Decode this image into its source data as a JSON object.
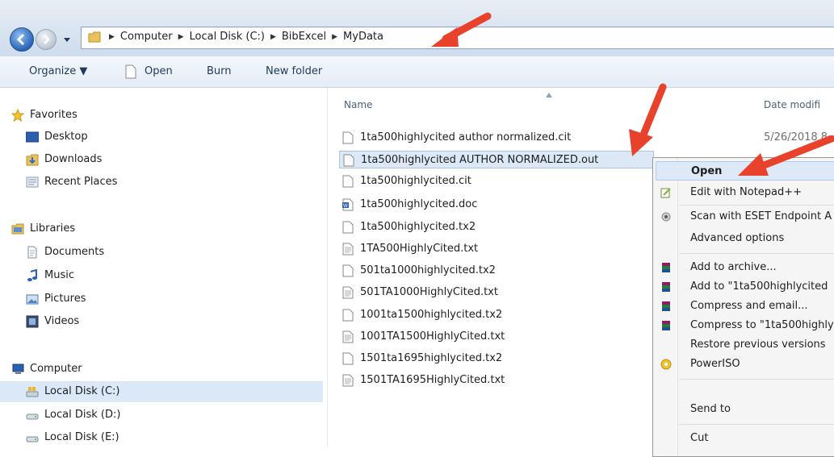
{
  "address": {
    "crumbs": [
      "Computer",
      "Local Disk (C:)",
      "BibExcel",
      "MyData"
    ]
  },
  "toolbar": {
    "organize": "Organize ▼",
    "open": "Open",
    "burn": "Burn",
    "new_folder": "New folder"
  },
  "sidebar": {
    "favorites": "Favorites",
    "desktop": "Desktop",
    "downloads": "Downloads",
    "recent": "Recent Places",
    "libraries": "Libraries",
    "documents": "Documents",
    "music": "Music",
    "pictures": "Pictures",
    "videos": "Videos",
    "computer": "Computer",
    "disk_c": "Local Disk (C:)",
    "disk_d": "Local Disk (D:)",
    "disk_e": "Local Disk (E:)"
  },
  "columns": {
    "name": "Name",
    "date": "Date modifi"
  },
  "files": [
    {
      "name": "1ta500highlycited author normalized.cit",
      "date": "5/26/2018 8"
    },
    {
      "name": "1ta500highlycited AUTHOR NORMALIZED.out",
      "date": ""
    },
    {
      "name": "1ta500highlycited.cit",
      "date": ""
    },
    {
      "name": "1ta500highlycited.doc",
      "date": ""
    },
    {
      "name": "1ta500highlycited.tx2",
      "date": ""
    },
    {
      "name": "1TA500HighlyCited.txt",
      "date": ""
    },
    {
      "name": "501ta1000highlycited.tx2",
      "date": ""
    },
    {
      "name": "501TA1000HighlyCited.txt",
      "date": ""
    },
    {
      "name": "1001ta1500highlycited.tx2",
      "date": ""
    },
    {
      "name": "1001TA1500HighlyCited.txt",
      "date": ""
    },
    {
      "name": "1501ta1695highlycited.tx2",
      "date": ""
    },
    {
      "name": "1501TA1695HighlyCited.txt",
      "date": ""
    }
  ],
  "context_menu": {
    "open": "Open",
    "edit_notepad": "Edit with Notepad++",
    "scan_eset": "Scan with ESET Endpoint A",
    "advanced": "Advanced options",
    "add_archive": "Add to archive...",
    "add_to_named": "Add to \"1ta500highlycited",
    "compress_email": "Compress and email...",
    "compress_to": "Compress to \"1ta500highly",
    "restore": "Restore previous versions",
    "poweriso": "PowerISO",
    "send_to": "Send to",
    "cut": "Cut"
  },
  "colors": {
    "annotation_arrow": "#e8412c",
    "selection": "#dde8f7"
  }
}
